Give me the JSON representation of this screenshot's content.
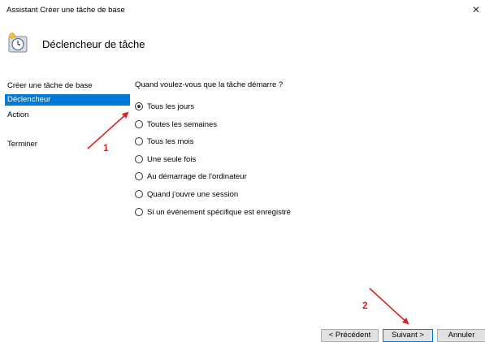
{
  "window": {
    "title": "Assistant Créer une tâche de base",
    "close_symbol": "✕"
  },
  "header": {
    "title": "Déclencheur de tâche",
    "icon": "task-scheduler-clock-icon"
  },
  "nav": {
    "items": [
      {
        "label": "Créer une tâche de base",
        "active": false
      },
      {
        "label": "Déclencheur",
        "active": true
      },
      {
        "label": "Action",
        "active": false
      },
      {
        "label": "Terminer",
        "active": false
      }
    ]
  },
  "trigger": {
    "question": "Quand voulez-vous que la tâche démarre ?",
    "options": [
      {
        "label": "Tous les jours",
        "checked": true
      },
      {
        "label": "Toutes les semaines",
        "checked": false
      },
      {
        "label": "Tous les mois",
        "checked": false
      },
      {
        "label": "Une seule fois",
        "checked": false
      },
      {
        "label": "Au démarrage de l'ordinateur",
        "checked": false
      },
      {
        "label": "Quand j'ouvre une session",
        "checked": false
      },
      {
        "label": "Si un événement spécifique est enregistré",
        "checked": false
      }
    ]
  },
  "buttons": {
    "previous": "< Précédent",
    "next": "Suivant >",
    "cancel": "Annuler"
  },
  "annotations": {
    "marker_1": "1",
    "marker_2": "2",
    "color": "#e02020"
  },
  "colors": {
    "selection": "#0078d7"
  }
}
